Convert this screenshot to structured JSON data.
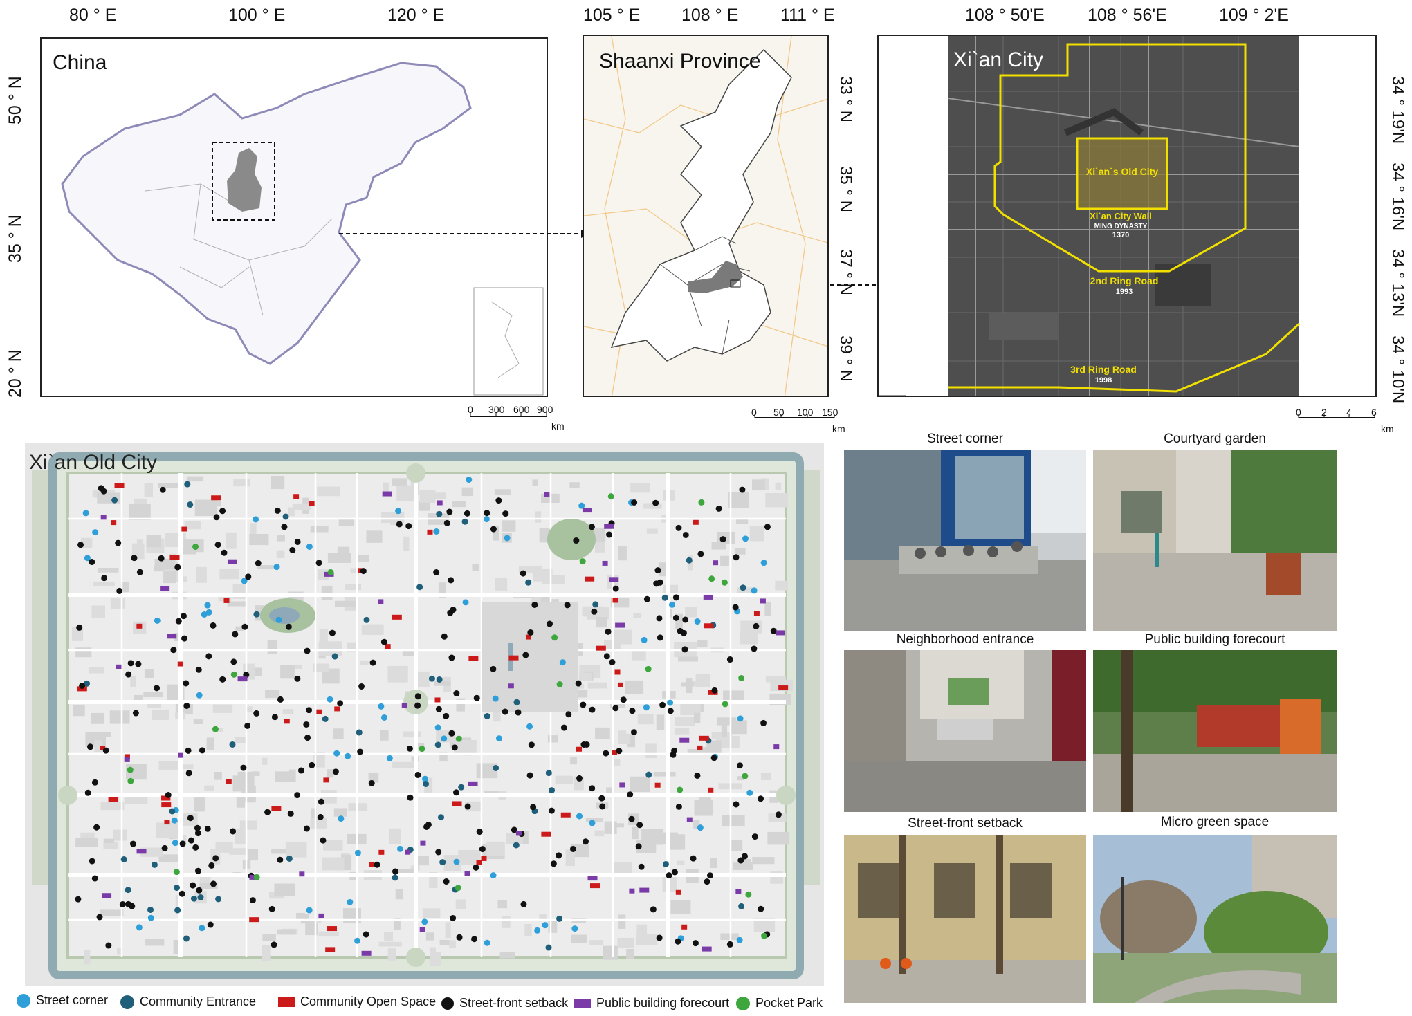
{
  "panels": {
    "china": {
      "title": "China",
      "x_ticks": [
        "80 ° E",
        "100 ° E",
        "120 ° E"
      ],
      "y_ticks": [
        "50 ° N",
        "35 ° N",
        "20 ° N"
      ],
      "scale": {
        "labels": [
          "0",
          "300",
          "600",
          "900"
        ],
        "unit": "km"
      }
    },
    "shaanxi": {
      "title": "Shaanxi Province",
      "x_ticks": [
        "105 ° E",
        "108 ° E",
        "111 ° E"
      ],
      "y_ticks": [
        "33 ° N",
        "35 ° N",
        "37 ° N",
        "39 ° N"
      ],
      "scale": {
        "labels": [
          "0",
          "50",
          "100",
          "150"
        ],
        "unit": "km"
      }
    },
    "xian": {
      "title": "Xi`an City",
      "x_ticks": [
        "108 ° 50'E",
        "108 ° 56'E",
        "109 ° 2'E"
      ],
      "y_ticks": [
        "34 ° 19'N",
        "34 ° 16'N",
        "34 ° 13'N",
        "34 ° 10'N"
      ],
      "scale": {
        "labels": [
          "0",
          "2",
          "4",
          "6"
        ],
        "unit": "km"
      },
      "annotations": {
        "old_city": "Xi`an`s Old City",
        "city_wall": "Xi`an City Wall",
        "ming": "Ming dynasty",
        "ming_year": "1370",
        "ring2": "2nd Ring Road",
        "ring2_year": "1993",
        "ring3": "3rd Ring Road",
        "ring3_year": "1998"
      }
    },
    "old_city": {
      "title": "Xi`an Old City"
    }
  },
  "photos": [
    {
      "title": "Street corner"
    },
    {
      "title": "Courtyard garden"
    },
    {
      "title": "Neighborhood entrance"
    },
    {
      "title": "Public building forecourt"
    },
    {
      "title": "Street-front setback"
    },
    {
      "title": "Micro green space"
    }
  ],
  "legend": [
    {
      "label": "Street corner",
      "color": "#2e9fd8",
      "shape": "circle"
    },
    {
      "label": "Community Entrance",
      "color": "#1f5f7a",
      "shape": "circle"
    },
    {
      "label": "Community Open Space",
      "color": "#cc1a1a",
      "shape": "rect"
    },
    {
      "label": "Street-front setback",
      "color": "#111111",
      "shape": "circle"
    },
    {
      "label": "Public building forecourt",
      "color": "#7a3aa8",
      "shape": "rect"
    },
    {
      "label": "Pocket Park",
      "color": "#3da63d",
      "shape": "circle"
    }
  ]
}
